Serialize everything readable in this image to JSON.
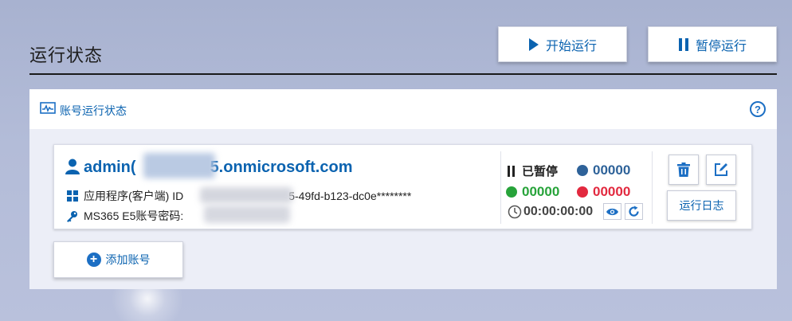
{
  "page": {
    "title": "运行状态"
  },
  "toolbar": {
    "start_label": "开始运行",
    "pause_label": "暂停运行"
  },
  "panel": {
    "title": "账号运行状态",
    "help_label": "?"
  },
  "account": {
    "email": "admin@██████5.onmicrosoft.com",
    "email_prefix": "admin(",
    "email_suffix": "5.onmicrosoft.com",
    "app_label": "应用程序(客户端) ID",
    "app_id_suffix": "5-49fd-b123-dc0e********",
    "password_label": "MS365 E5账号密码:",
    "status": "已暂停",
    "count_blue": "00000",
    "count_green": "00000",
    "count_red": "00000",
    "timer": "00:00:00:00",
    "log_label": "运行日志"
  },
  "add_account_label": "添加账号",
  "colors": {
    "accent": "#0b63b0",
    "blue_dot": "#2e6299",
    "green_dot": "#27a33a",
    "red_dot": "#e2293f"
  }
}
